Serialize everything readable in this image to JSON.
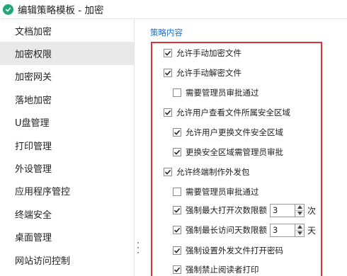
{
  "window": {
    "title": "编辑策略模板 - 加密"
  },
  "sidebar": {
    "items": [
      {
        "label": "文档加密",
        "active": false
      },
      {
        "label": "加密权限",
        "active": true
      },
      {
        "label": "加密网关",
        "active": false
      },
      {
        "label": "落地加密",
        "active": false
      },
      {
        "label": "U盘管理",
        "active": false
      },
      {
        "label": "打印管理",
        "active": false
      },
      {
        "label": "外设管理",
        "active": false
      },
      {
        "label": "应用程序管控",
        "active": false
      },
      {
        "label": "终端安全",
        "active": false
      },
      {
        "label": "桌面管理",
        "active": false
      },
      {
        "label": "网站访问控制",
        "active": false
      }
    ]
  },
  "policy": {
    "section_title": "策略内容",
    "options": [
      {
        "label": "允许手动加密文件",
        "checked": true
      },
      {
        "label": "允许手动解密文件",
        "checked": true
      },
      {
        "label": "需要管理员审批通过",
        "checked": false
      },
      {
        "label": "允许用户查看文件所属安全区域",
        "checked": true
      },
      {
        "label": "允许用户更换文件安全区域",
        "checked": true
      },
      {
        "label": "更换安全区域需管理员审批",
        "checked": true
      },
      {
        "label": "允许终端制作外发包",
        "checked": true
      },
      {
        "label": "需要管理员审批通过",
        "checked": false
      },
      {
        "label": "强制最大打开次数限额",
        "checked": true,
        "value": "3",
        "unit": "次"
      },
      {
        "label": "强制最长访问天数限额",
        "checked": true,
        "value": "3",
        "unit": "天"
      },
      {
        "label": "强制设置外发文件打开密码",
        "checked": true
      },
      {
        "label": "强制禁止阅读者打印",
        "checked": true
      }
    ]
  },
  "colors": {
    "accent": "#1a73c8",
    "highlight_border": "#e0303a",
    "active_sidebar": "#e9e9e9",
    "app_icon": "#1fa67a"
  }
}
